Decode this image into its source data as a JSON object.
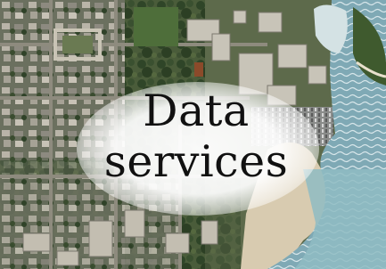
{
  "banner": {
    "title_line1": "Data",
    "title_line2": "services"
  },
  "map": {
    "type": "aerial-photo",
    "features": [
      "residential-blocks",
      "tree-canopy",
      "campus-buildings",
      "parking-lot",
      "sandy-beach",
      "lake-shoreline",
      "lake-water"
    ]
  },
  "colors": {
    "text": "#111111",
    "glow": "#ffffff",
    "water": "#8fbcc3",
    "vegetation": "#3f5a2e"
  }
}
